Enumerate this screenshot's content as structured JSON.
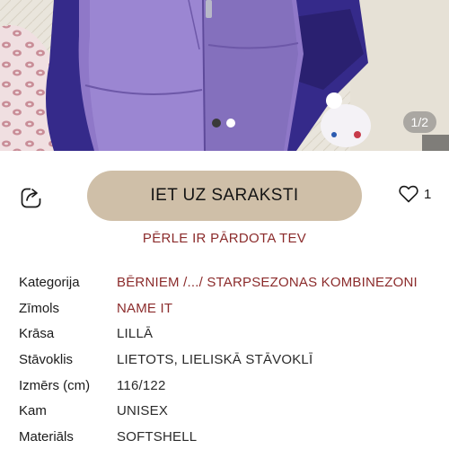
{
  "gallery": {
    "counter": "1/2",
    "total_images": 2,
    "active_index": 1
  },
  "actions": {
    "share_icon": "share-icon",
    "cta_label": "IET UZ SARAKSTI",
    "like_icon": "heart-icon",
    "like_count": "1"
  },
  "status_text": "PĒRLE IR PĀRDOTA TEV",
  "details": {
    "category": {
      "label": "Kategorija",
      "value": "BĒRNIEM /.../ STARPSEZONAS KOMBINEZONI"
    },
    "brand": {
      "label": "Zīmols",
      "value": "NAME IT"
    },
    "color": {
      "label": "Krāsa",
      "value": "LILLĀ"
    },
    "condition": {
      "label": "Stāvoklis",
      "value": "LIETOTS, LIELISKĀ STĀVOKLĪ"
    },
    "size": {
      "label": "Izmērs (cm)",
      "value": "116/122"
    },
    "gender": {
      "label": "Kam",
      "value": "UNISEX"
    },
    "material": {
      "label": "Materiāls",
      "value": "SOFTSHELL"
    }
  },
  "colors": {
    "cta_bg": "#cfbfa8",
    "accent_red": "#8b2b2b",
    "garment_lilac": "#8f78c8",
    "garment_navy": "#352a8a"
  }
}
